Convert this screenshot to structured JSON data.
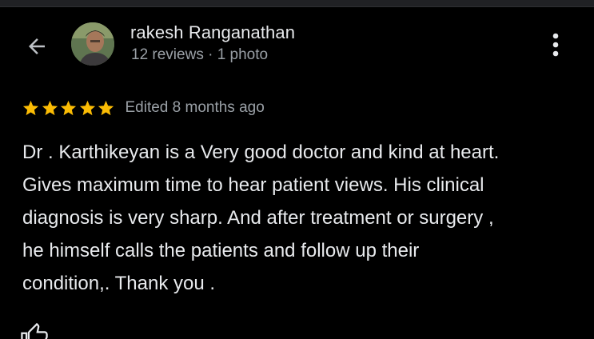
{
  "reviewer": {
    "name": "rakesh Ranganathan",
    "meta": "12 reviews · 1 photo"
  },
  "rating": {
    "stars": 5,
    "edited_label": "Edited 8 months ago"
  },
  "review": {
    "lines": [
      "Dr . Karthikeyan is a Very good doctor and kind at heart.",
      "Gives maximum time to hear patient views. His clinical",
      "diagnosis is very sharp. And after treatment or surgery ,",
      "he himself calls the patients and follow up their",
      "condition,. Thank you ."
    ]
  },
  "icons": {
    "back": "arrow-left-icon",
    "more": "more-vert-icon",
    "star": "star-icon",
    "bottom": "thumbs-up-icon"
  },
  "colors": {
    "background": "#000000",
    "primary_text": "#e8eaed",
    "secondary_text": "#9aa0a6",
    "star": "#fbbc04"
  }
}
